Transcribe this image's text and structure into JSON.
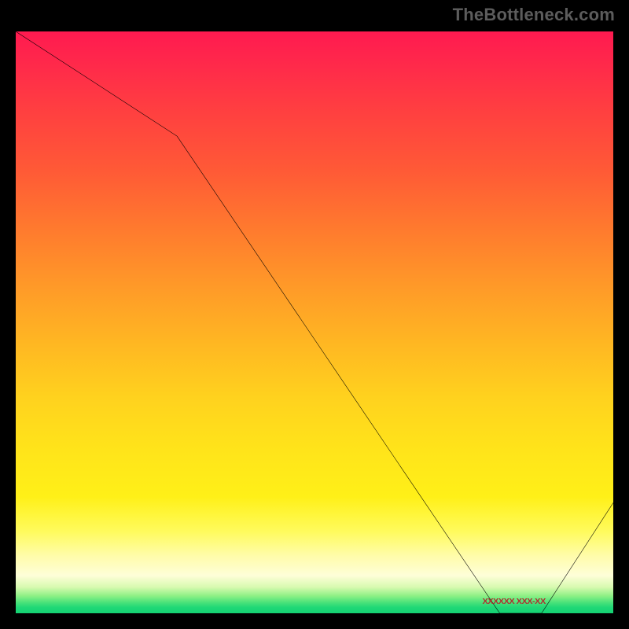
{
  "watermark": "TheBottleneck.com",
  "series_label": "XXXXXX XXX-XX",
  "chart_data": {
    "type": "line",
    "title": "",
    "xlabel": "",
    "ylabel": "",
    "xlim": [
      0,
      100
    ],
    "ylim": [
      0,
      100
    ],
    "x": [
      0,
      27,
      81,
      88,
      100
    ],
    "values": [
      100,
      82,
      0,
      0,
      19
    ],
    "gradient_stops": [
      {
        "pct": 0,
        "color": "#ff1a50"
      },
      {
        "pct": 24,
        "color": "#ff5a36"
      },
      {
        "pct": 54,
        "color": "#ffb822"
      },
      {
        "pct": 80,
        "color": "#fff018"
      },
      {
        "pct": 93.5,
        "color": "#fefed8"
      },
      {
        "pct": 100,
        "color": "#14d273"
      }
    ],
    "label_position_pct": {
      "x": 81,
      "y": 2
    }
  },
  "colors": {
    "background": "#000000",
    "watermark": "#5c5c5c",
    "line": "#000000",
    "series_label": "#b03030"
  }
}
